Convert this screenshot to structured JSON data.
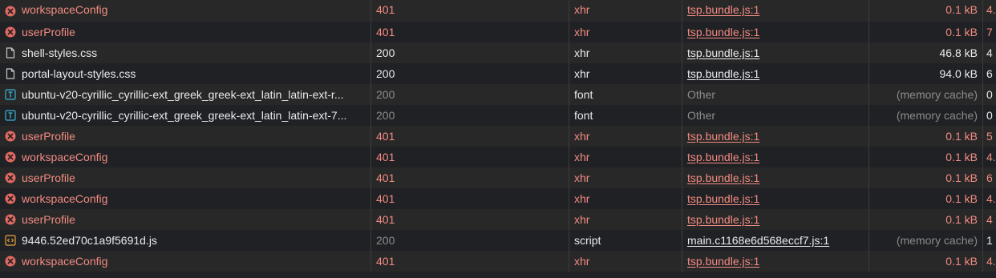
{
  "colors": {
    "row_even": "#282828",
    "row_odd": "#202124",
    "error_text": "#f28b82",
    "normal_text": "#e8eaed",
    "dim_text": "#8c8c8c",
    "font_icon": "#39b4d6",
    "script_icon": "#e8a33d"
  },
  "rows": [
    {
      "name": "workspaceConfig",
      "status": "401",
      "type": "xhr",
      "initiator": "tsp.bundle.js:1",
      "size": "0.1 kB",
      "time": "4.",
      "icon": "error-icon",
      "state": "error"
    },
    {
      "name": "userProfile",
      "status": "401",
      "type": "xhr",
      "initiator": "tsp.bundle.js:1",
      "size": "0.1 kB",
      "time": "7",
      "icon": "error-icon",
      "state": "error"
    },
    {
      "name": "shell-styles.css",
      "status": "200",
      "type": "xhr",
      "initiator": "tsp.bundle.js:1",
      "size": "46.8 kB",
      "time": "4",
      "icon": "document-icon",
      "state": "ok"
    },
    {
      "name": "portal-layout-styles.css",
      "status": "200",
      "type": "xhr",
      "initiator": "tsp.bundle.js:1",
      "size": "94.0 kB",
      "time": "6",
      "icon": "document-icon",
      "state": "ok"
    },
    {
      "name": "ubuntu-v20-cyrillic_cyrillic-ext_greek_greek-ext_latin_latin-ext-r...",
      "status": "200",
      "type": "font",
      "initiator": "Other",
      "size": "(memory cache)",
      "time": "0",
      "icon": "font-icon",
      "state": "cached"
    },
    {
      "name": "ubuntu-v20-cyrillic_cyrillic-ext_greek_greek-ext_latin_latin-ext-7...",
      "status": "200",
      "type": "font",
      "initiator": "Other",
      "size": "(memory cache)",
      "time": "0",
      "icon": "font-icon",
      "state": "cached"
    },
    {
      "name": "userProfile",
      "status": "401",
      "type": "xhr",
      "initiator": "tsp.bundle.js:1",
      "size": "0.1 kB",
      "time": "5",
      "icon": "error-icon",
      "state": "error"
    },
    {
      "name": "workspaceConfig",
      "status": "401",
      "type": "xhr",
      "initiator": "tsp.bundle.js:1",
      "size": "0.1 kB",
      "time": "4.",
      "icon": "error-icon",
      "state": "error"
    },
    {
      "name": "userProfile",
      "status": "401",
      "type": "xhr",
      "initiator": "tsp.bundle.js:1",
      "size": "0.1 kB",
      "time": "6",
      "icon": "error-icon",
      "state": "error"
    },
    {
      "name": "workspaceConfig",
      "status": "401",
      "type": "xhr",
      "initiator": "tsp.bundle.js:1",
      "size": "0.1 kB",
      "time": "4.",
      "icon": "error-icon",
      "state": "error"
    },
    {
      "name": "userProfile",
      "status": "401",
      "type": "xhr",
      "initiator": "tsp.bundle.js:1",
      "size": "0.1 kB",
      "time": "4",
      "icon": "error-icon",
      "state": "error"
    },
    {
      "name": "9446.52ed70c1a9f5691d.js",
      "status": "200",
      "type": "script",
      "initiator": "main.c1168e6d568eccf7.js:1",
      "size": "(memory cache)",
      "time": "1",
      "icon": "script-icon",
      "state": "script"
    },
    {
      "name": "workspaceConfig",
      "status": "401",
      "type": "xhr",
      "initiator": "tsp.bundle.js:1",
      "size": "0.1 kB",
      "time": "4.",
      "icon": "error-icon",
      "state": "error"
    }
  ]
}
